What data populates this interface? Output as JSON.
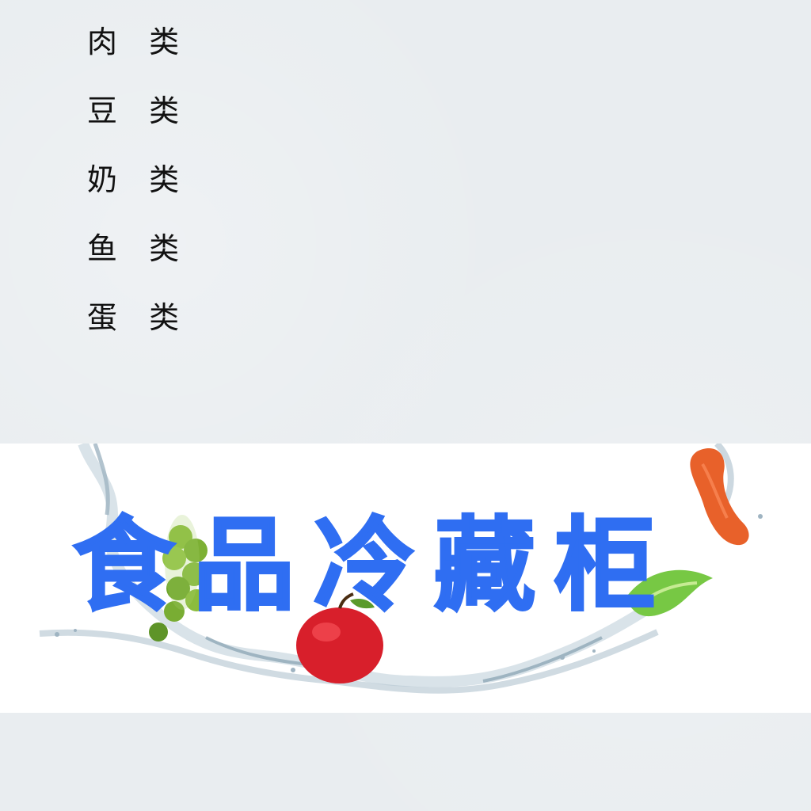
{
  "categories": [
    "肉 类",
    "豆 类",
    "奶 类",
    "鱼 类",
    "蛋 类"
  ],
  "banner": {
    "title": "食品冷藏柜",
    "title_color": "#2f6ef2",
    "background": "#ffffff"
  },
  "decorations": [
    "grapes-icon",
    "apple-icon",
    "sausage-icon",
    "lettuce-icon",
    "water-splash-icon"
  ],
  "colors": {
    "page_background": "#e9edf0",
    "text": "#111111"
  }
}
